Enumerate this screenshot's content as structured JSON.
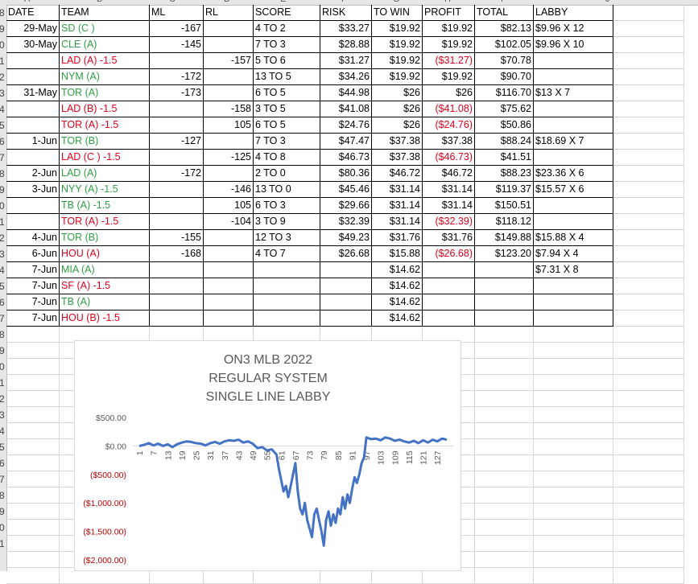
{
  "column_headers": [
    "A",
    "B",
    "C",
    "D",
    "E",
    "F",
    "G",
    "H",
    "I",
    "J"
  ],
  "row_numbers": [
    "8",
    "9",
    "0",
    "1",
    "2",
    "3",
    "4",
    "5",
    "6",
    "7",
    "8",
    "9",
    "0",
    "1",
    "2",
    "3",
    "4",
    "5",
    "6",
    "7",
    "8",
    "9",
    "0",
    "1",
    "2",
    "3",
    "4",
    "5",
    "6",
    "7",
    "8",
    "9",
    "0",
    "1"
  ],
  "table": {
    "headers": [
      "DATE",
      "TEAM",
      "ML",
      "RL",
      "SCORE",
      "RISK",
      "TO WIN",
      "PROFIT",
      "TOTAL",
      "LABBY"
    ],
    "rows": [
      {
        "date": "29-May",
        "team": "SD (C )",
        "tc": "green",
        "ml": "-167",
        "rl": "",
        "score": "4 TO 2",
        "risk": "$33.27",
        "towin": "$19.92",
        "profit": "$19.92",
        "pc": "",
        "total": "$82.13",
        "labby": "$9.96 X 12"
      },
      {
        "date": "30-May",
        "team": "CLE (A)",
        "tc": "green",
        "ml": "-145",
        "rl": "",
        "score": "7 TO 3",
        "risk": "$28.88",
        "towin": "$19.92",
        "profit": "$19.92",
        "pc": "",
        "total": "$102.05",
        "labby": "$9.96 X 10"
      },
      {
        "date": "",
        "team": "LAD (A) -1.5",
        "tc": "red",
        "ml": "",
        "rl": "-157",
        "score": "5 TO 6",
        "risk": "$31.27",
        "towin": "$19.92",
        "profit": "($31.27)",
        "pc": "red",
        "total": "$70.78",
        "labby": ""
      },
      {
        "date": "",
        "team": "NYM (A)",
        "tc": "green",
        "ml": "-172",
        "rl": "",
        "score": "13 TO 5",
        "risk": "$34.26",
        "towin": "$19.92",
        "profit": "$19.92",
        "pc": "",
        "total": "$90.70",
        "labby": ""
      },
      {
        "date": "31-May",
        "team": "TOR (A)",
        "tc": "green",
        "ml": "-173",
        "rl": "",
        "score": "6 TO 5",
        "risk": "$44.98",
        "towin": "$26",
        "profit": "$26",
        "pc": "",
        "total": "$116.70",
        "labby": "$13 X 7"
      },
      {
        "date": "",
        "team": "LAD (B) -1.5",
        "tc": "red",
        "ml": "",
        "rl": "-158",
        "score": "3 TO 5",
        "risk": "$41.08",
        "towin": "$26",
        "profit": "($41.08)",
        "pc": "red",
        "total": "$75.62",
        "labby": ""
      },
      {
        "date": "",
        "team": "TOR (A) -1.5",
        "tc": "red",
        "ml": "",
        "rl": "105",
        "score": "6 TO 5",
        "risk": "$24.76",
        "towin": "$26",
        "profit": "($24.76)",
        "pc": "red",
        "total": "$50.86",
        "labby": ""
      },
      {
        "date": "1-Jun",
        "team": "TOR (B)",
        "tc": "green",
        "ml": "-127",
        "rl": "",
        "score": "7 TO 3",
        "risk": "$47.47",
        "towin": "$37.38",
        "profit": "$37.38",
        "pc": "",
        "total": "$88.24",
        "labby": "$18.69 X 7"
      },
      {
        "date": "",
        "team": "LAD (C ) -1.5",
        "tc": "red",
        "ml": "",
        "rl": "-125",
        "score": "4 TO 8",
        "risk": "$46.73",
        "towin": "$37.38",
        "profit": "($46.73)",
        "pc": "red",
        "total": "$41.51",
        "labby": ""
      },
      {
        "date": "2-Jun",
        "team": "LAD (A)",
        "tc": "green",
        "ml": "-172",
        "rl": "",
        "score": "2 TO 0",
        "risk": "$80.36",
        "towin": "$46.72",
        "profit": "$46.72",
        "pc": "",
        "total": "$88.23",
        "labby": "$23.36 X 6"
      },
      {
        "date": "3-Jun",
        "team": "NYY (A) -1.5",
        "tc": "green",
        "ml": "",
        "rl": "-146",
        "score": "13 TO 0",
        "risk": "$45.46",
        "towin": "$31.14",
        "profit": "$31.14",
        "pc": "",
        "total": "$119.37",
        "labby": "$15.57 X 6"
      },
      {
        "date": "",
        "team": "TB (A) -1.5",
        "tc": "green",
        "ml": "",
        "rl": "105",
        "score": "6 TO 3",
        "risk": "$29.66",
        "towin": "$31.14",
        "profit": "$31.14",
        "pc": "",
        "total": "$150.51",
        "labby": ""
      },
      {
        "date": "",
        "team": "TOR (A) -1.5",
        "tc": "red",
        "ml": "",
        "rl": "-104",
        "score": "3 TO 9",
        "risk": "$32.39",
        "towin": "$31.14",
        "profit": "($32.39)",
        "pc": "red",
        "total": "$118.12",
        "labby": ""
      },
      {
        "date": "4-Jun",
        "team": "TOR (B)",
        "tc": "green",
        "ml": "-155",
        "rl": "",
        "score": "12 TO 3",
        "risk": "$49.23",
        "towin": "$31.76",
        "profit": "$31.76",
        "pc": "",
        "total": "$149.88",
        "labby": "$15.88 X 4"
      },
      {
        "date": "6-Jun",
        "team": "HOU (A)",
        "tc": "red",
        "ml": "-168",
        "rl": "",
        "score": "4 TO 7",
        "risk": "$26.68",
        "towin": "$15.88",
        "profit": "($26.68)",
        "pc": "red",
        "total": "$123.20",
        "labby": "$7.94 X 4"
      },
      {
        "date": "7-Jun",
        "team": "MIA (A)",
        "tc": "green",
        "ml": "",
        "rl": "",
        "score": "",
        "risk": "",
        "towin": "$14.62",
        "profit": "",
        "pc": "",
        "total": "",
        "labby": "$7.31 X 8"
      },
      {
        "date": "7-Jun",
        "team": "SF (A) -1.5",
        "tc": "red",
        "ml": "",
        "rl": "",
        "score": "",
        "risk": "",
        "towin": "$14.62",
        "profit": "",
        "pc": "",
        "total": "",
        "labby": ""
      },
      {
        "date": "7-Jun",
        "team": "TB (A)",
        "tc": "green",
        "ml": "",
        "rl": "",
        "score": "",
        "risk": "",
        "towin": "$14.62",
        "profit": "",
        "pc": "",
        "total": "",
        "labby": ""
      },
      {
        "date": "7-Jun",
        "team": "HOU (B) -1.5",
        "tc": "red",
        "ml": "",
        "rl": "",
        "score": "",
        "risk": "",
        "towin": "$14.62",
        "profit": "",
        "pc": "",
        "total": "",
        "labby": ""
      }
    ]
  },
  "colors": {
    "win": "#2ea043",
    "loss": "#e0001a",
    "line": "#4472c4",
    "neg_axis": "#c00000"
  },
  "chart_data": {
    "type": "line",
    "title": [
      "ON3 MLB 2022",
      "REGULAR SYSTEM",
      "SINGLE LINE LABBY"
    ],
    "xlabel": "",
    "ylabel": "",
    "ylim": [
      -2000,
      500
    ],
    "y_ticks": [
      500,
      0,
      -500,
      -1000,
      -1500,
      -2000
    ],
    "y_tick_labels": [
      "$500.00",
      "$0.00",
      "($500.00)",
      "($1,000.00)",
      "($1,500.00)",
      "($2,000.00)"
    ],
    "x_tick_labels": [
      "1",
      "7",
      "13",
      "19",
      "25",
      "31",
      "37",
      "43",
      "49",
      "55",
      "61",
      "67",
      "73",
      "79",
      "85",
      "91",
      "97",
      "103",
      "109",
      "115",
      "121",
      "127"
    ],
    "x_tick_values": [
      1,
      7,
      13,
      19,
      25,
      31,
      37,
      43,
      49,
      55,
      61,
      67,
      73,
      79,
      85,
      91,
      97,
      103,
      109,
      115,
      121,
      127
    ],
    "grid": false,
    "legend": "none",
    "series": [
      {
        "x": [
          1,
          3,
          5,
          7,
          9,
          11,
          13,
          15,
          17,
          19,
          21,
          23,
          25,
          27,
          29,
          31,
          33,
          35,
          37,
          39,
          41,
          43,
          45,
          47,
          49,
          51,
          53,
          55,
          57,
          59,
          60,
          61,
          62,
          63,
          64,
          65,
          66,
          67,
          68,
          69,
          70,
          71,
          72,
          73,
          74,
          75,
          76,
          77,
          78,
          79,
          80,
          81,
          82,
          83,
          84,
          85,
          86,
          87,
          88,
          89,
          90,
          91,
          92,
          93,
          94,
          95,
          96,
          97,
          99,
          101,
          103,
          105,
          107,
          109,
          111,
          113,
          115,
          117,
          119,
          121,
          123,
          125,
          127,
          129,
          131
        ],
        "y": [
          0,
          20,
          50,
          10,
          40,
          0,
          30,
          -20,
          30,
          60,
          80,
          70,
          50,
          40,
          10,
          50,
          70,
          40,
          80,
          100,
          90,
          110,
          60,
          80,
          40,
          -40,
          -20,
          -80,
          -60,
          -150,
          -400,
          -600,
          -800,
          -700,
          -900,
          -700,
          -500,
          -300,
          -800,
          -1100,
          -1200,
          -1000,
          -1300,
          -1450,
          -1600,
          -1200,
          -1100,
          -1300,
          -1500,
          -1750,
          -1300,
          -1150,
          -1400,
          -1200,
          -1350,
          -1100,
          -1200,
          -900,
          -1100,
          -850,
          -1000,
          -750,
          -550,
          -650,
          -500,
          -300,
          -200,
          150,
          120,
          130,
          100,
          150,
          130,
          90,
          110,
          80,
          60,
          90,
          50,
          100,
          60,
          110,
          80,
          130,
          110
        ]
      }
    ]
  }
}
